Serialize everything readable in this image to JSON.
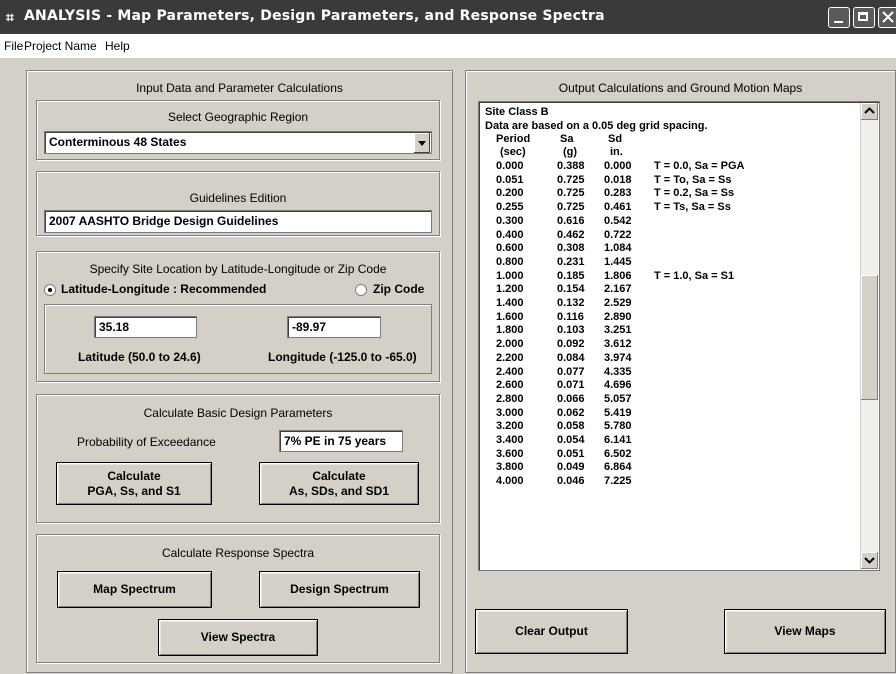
{
  "window": {
    "title": "ANALYSIS - Map Parameters, Design Parameters, and Response Spectra"
  },
  "menu": {
    "items": [
      {
        "label": "File"
      },
      {
        "label": "Project Name"
      },
      {
        "label": "Help"
      }
    ]
  },
  "left": {
    "header": "Input Data and Parameter Calculations",
    "region": {
      "label": "Select Geographic Region",
      "value": "Conterminous 48 States"
    },
    "edition": {
      "label": "Guidelines Edition",
      "value": "2007 AASHTO Bridge Design Guidelines"
    },
    "location": {
      "label": "Specify Site Location by Latitude-Longitude or Zip Code",
      "option_latlon": "Latitude-Longitude : Recommended",
      "option_zip": "Zip Code",
      "selected": "latlon",
      "latitude": "35.18",
      "longitude": "-89.97",
      "latitude_label": "Latitude (50.0 to 24.6)",
      "longitude_label": "Longitude (-125.0 to -65.0)"
    },
    "basic": {
      "label": "Calculate Basic Design Parameters",
      "prob_label": "Probability of Exceedance",
      "prob_value": "7% PE in 75 years",
      "btn1_line1": "Calculate",
      "btn1_line2": "PGA, Ss, and S1",
      "btn2_line1": "Calculate",
      "btn2_line2": "As, SDs, and SD1"
    },
    "spectra": {
      "label": "Calculate Response Spectra",
      "map_btn": "Map Spectrum",
      "design_btn": "Design Spectrum",
      "view_btn": "View Spectra"
    }
  },
  "right": {
    "header": "Output Calculations and Ground Motion Maps",
    "output": {
      "site_class": "Site Class B",
      "grid_note": "Data are based on a 0.05 deg grid spacing.",
      "col_period": "Period",
      "col_sa": "Sa",
      "col_sd": "Sd",
      "unit_period": "(sec)",
      "unit_sa": "(g)",
      "unit_sd": "in.",
      "rows": [
        {
          "period": "0.000",
          "sa": "0.388",
          "sd": "0.000",
          "note": "T = 0.0, Sa = PGA"
        },
        {
          "period": "0.051",
          "sa": "0.725",
          "sd": "0.018",
          "note": "T = To,  Sa = Ss"
        },
        {
          "period": "0.200",
          "sa": "0.725",
          "sd": "0.283",
          "note": "T = 0.2, Sa = Ss"
        },
        {
          "period": "0.255",
          "sa": "0.725",
          "sd": "0.461",
          "note": "T = Ts,  Sa = Ss"
        },
        {
          "period": "0.300",
          "sa": "0.616",
          "sd": "0.542",
          "note": ""
        },
        {
          "period": "0.400",
          "sa": "0.462",
          "sd": "0.722",
          "note": ""
        },
        {
          "period": "0.600",
          "sa": "0.308",
          "sd": "1.084",
          "note": ""
        },
        {
          "period": "0.800",
          "sa": "0.231",
          "sd": "1.445",
          "note": ""
        },
        {
          "period": "1.000",
          "sa": "0.185",
          "sd": "1.806",
          "note": "T = 1.0, Sa = S1"
        },
        {
          "period": "1.200",
          "sa": "0.154",
          "sd": "2.167",
          "note": ""
        },
        {
          "period": "1.400",
          "sa": "0.132",
          "sd": "2.529",
          "note": ""
        },
        {
          "period": "1.600",
          "sa": "0.116",
          "sd": "2.890",
          "note": ""
        },
        {
          "period": "1.800",
          "sa": "0.103",
          "sd": "3.251",
          "note": ""
        },
        {
          "period": "2.000",
          "sa": "0.092",
          "sd": "3.612",
          "note": ""
        },
        {
          "period": "2.200",
          "sa": "0.084",
          "sd": "3.974",
          "note": ""
        },
        {
          "period": "2.400",
          "sa": "0.077",
          "sd": "4.335",
          "note": ""
        },
        {
          "period": "2.600",
          "sa": "0.071",
          "sd": "4.696",
          "note": ""
        },
        {
          "period": "2.800",
          "sa": "0.066",
          "sd": "5.057",
          "note": ""
        },
        {
          "period": "3.000",
          "sa": "0.062",
          "sd": "5.419",
          "note": ""
        },
        {
          "period": "3.200",
          "sa": "0.058",
          "sd": "5.780",
          "note": ""
        },
        {
          "period": "3.400",
          "sa": "0.054",
          "sd": "6.141",
          "note": ""
        },
        {
          "period": "3.600",
          "sa": "0.051",
          "sd": "6.502",
          "note": ""
        },
        {
          "period": "3.800",
          "sa": "0.049",
          "sd": "6.864",
          "note": ""
        },
        {
          "period": "4.000",
          "sa": "0.046",
          "sd": "7.225",
          "note": ""
        }
      ]
    },
    "clear_btn": "Clear Output",
    "view_maps_btn": "View Maps"
  }
}
